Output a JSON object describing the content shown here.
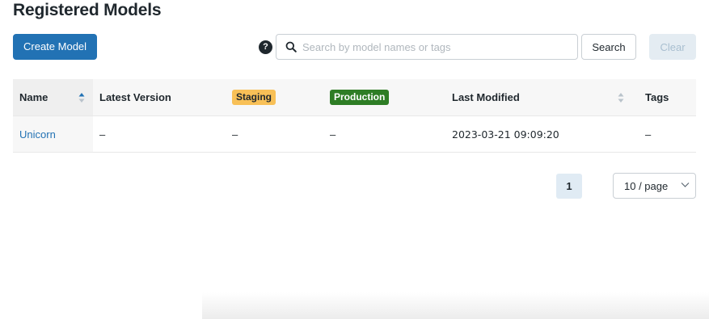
{
  "page": {
    "title": "Registered Models"
  },
  "toolbar": {
    "create_label": "Create Model",
    "help_glyph": "?",
    "search_placeholder": "Search by model names or tags",
    "search_value": "",
    "search_label": "Search",
    "clear_label": "Clear"
  },
  "table": {
    "columns": {
      "name": "Name",
      "latest_version": "Latest Version",
      "staging": "Staging",
      "production": "Production",
      "last_modified": "Last Modified",
      "tags": "Tags"
    },
    "rows": [
      {
        "name": "Unicorn",
        "latest_version": "–",
        "staging": "–",
        "production": "–",
        "last_modified": "2023-03-21 09:09:20",
        "tags": "–"
      }
    ]
  },
  "pagination": {
    "current_page": "1",
    "page_size": "10 / page"
  },
  "colors": {
    "primary": "#2272b4",
    "staging_badge": "#f8c057",
    "production_badge": "#2e7d25",
    "active_sort": "#2272b4"
  },
  "icons": {
    "help": "question-circle-icon",
    "search": "magnifier-icon",
    "sort": "sort-arrows-icon",
    "page_size": "chevron-down-icon"
  }
}
